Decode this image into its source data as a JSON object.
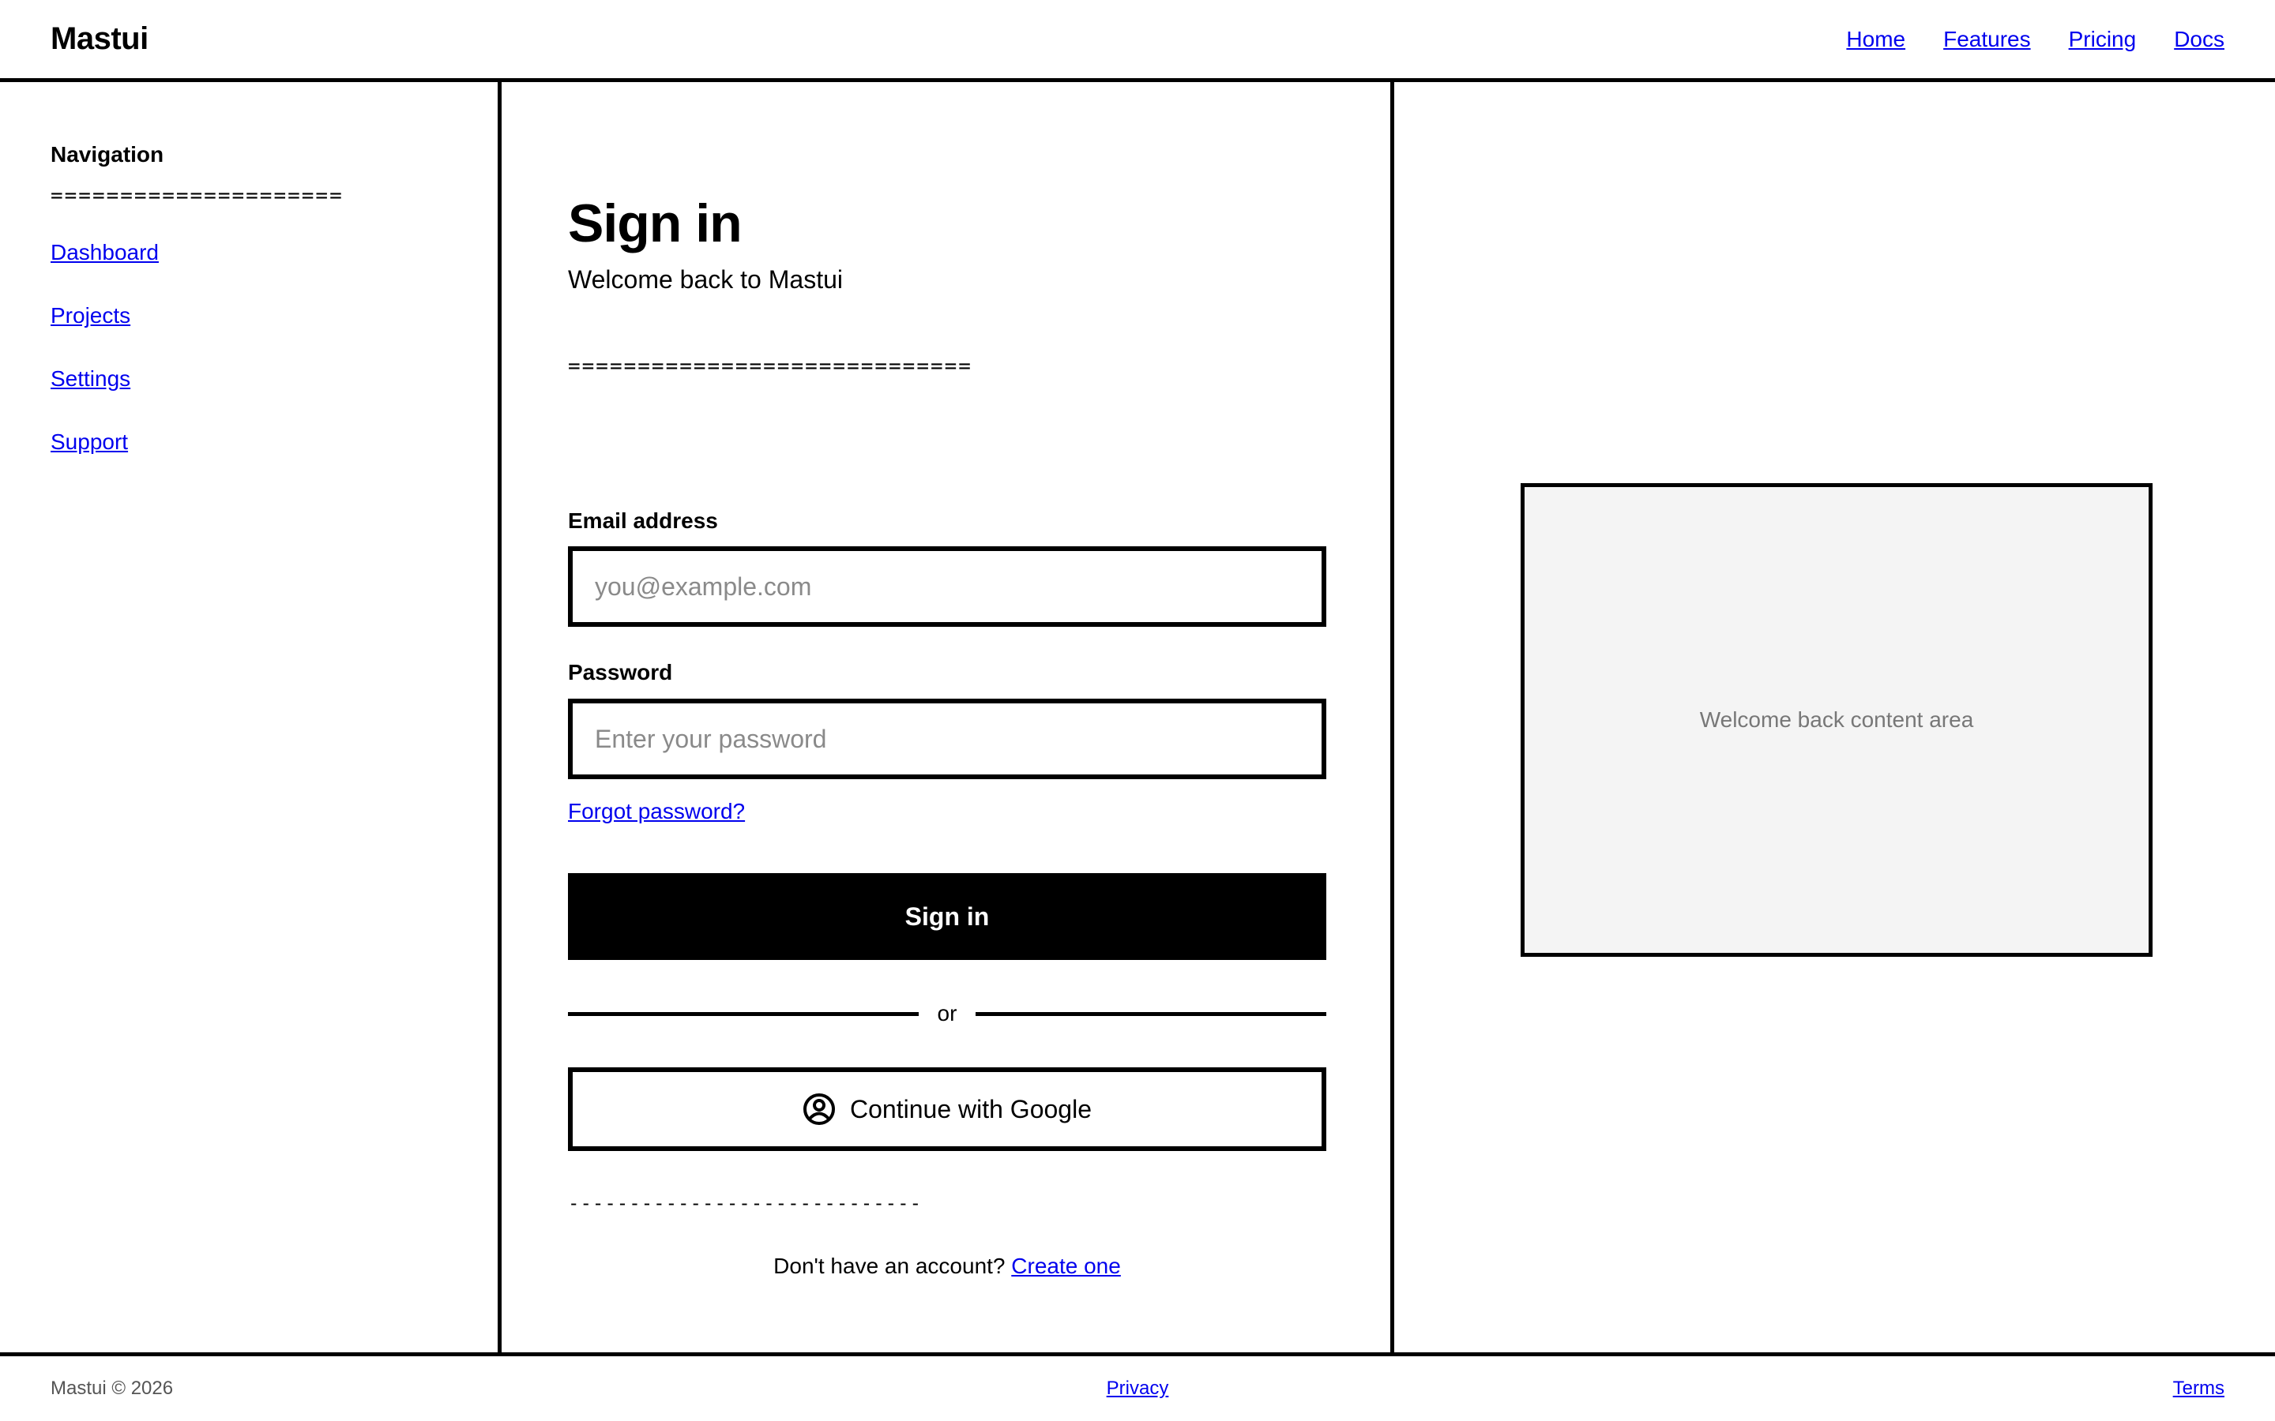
{
  "header": {
    "logo": "Mastui",
    "nav": [
      "Home",
      "Features",
      "Pricing",
      "Docs"
    ]
  },
  "sidebar": {
    "heading": "Navigation",
    "rule": "=====================",
    "items": [
      "Dashboard",
      "Projects",
      "Settings",
      "Support"
    ]
  },
  "main": {
    "title": "Sign in",
    "subtitle": "Welcome back to Mastui",
    "rule": "=============================",
    "email": {
      "label": "Email address",
      "placeholder": "you@example.com"
    },
    "password": {
      "label": "Password",
      "placeholder": "Enter your password"
    },
    "forgot": "Forgot password?",
    "submit": "Sign in",
    "divider": "or",
    "google": {
      "label": "Continue with Google",
      "icon": "user-circle-icon"
    },
    "dash_rule": "-----------------------------",
    "signup": {
      "text": "Don't have an account?",
      "link": "Create one"
    }
  },
  "right_panel": {
    "placeholder": "Welcome back content area"
  },
  "footer": {
    "copyright": "Mastui © 2026",
    "privacy": "Privacy",
    "terms": "Terms"
  }
}
